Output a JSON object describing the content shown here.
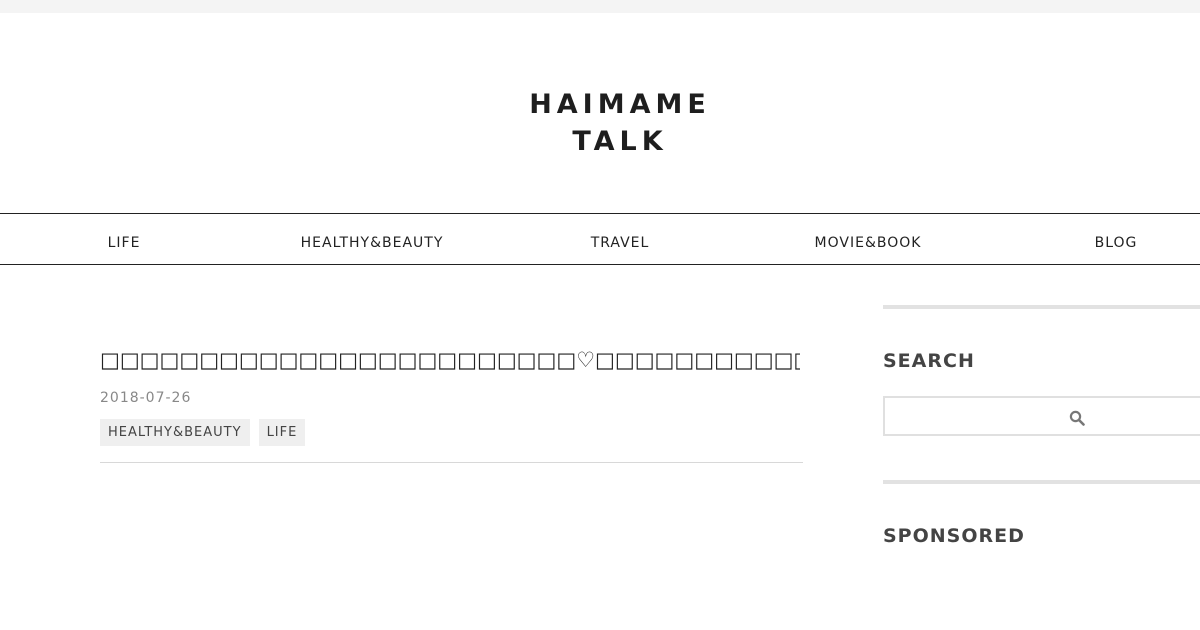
{
  "site": {
    "logo_line1": "HAIMAME",
    "logo_line2": "TALK"
  },
  "nav": {
    "items": [
      "LIFE",
      "HEALTHY&BEAUTY",
      "TRAVEL",
      "MOVIE&BOOK",
      "BLOG"
    ]
  },
  "post": {
    "title": "□□□□□□□□□□□□□□□□□□□□□□□□♡□□□□□□□□□□□□",
    "date": "2018-07-26",
    "tags": [
      "HEALTHY&BEAUTY",
      "LIFE"
    ]
  },
  "sidebar": {
    "search_heading": "SEARCH",
    "search_value": "",
    "sponsored_heading": "SPONSORED"
  },
  "colors": {
    "text": "#222222",
    "tag_bg": "#efefef",
    "rule": "#e2e2e2"
  }
}
